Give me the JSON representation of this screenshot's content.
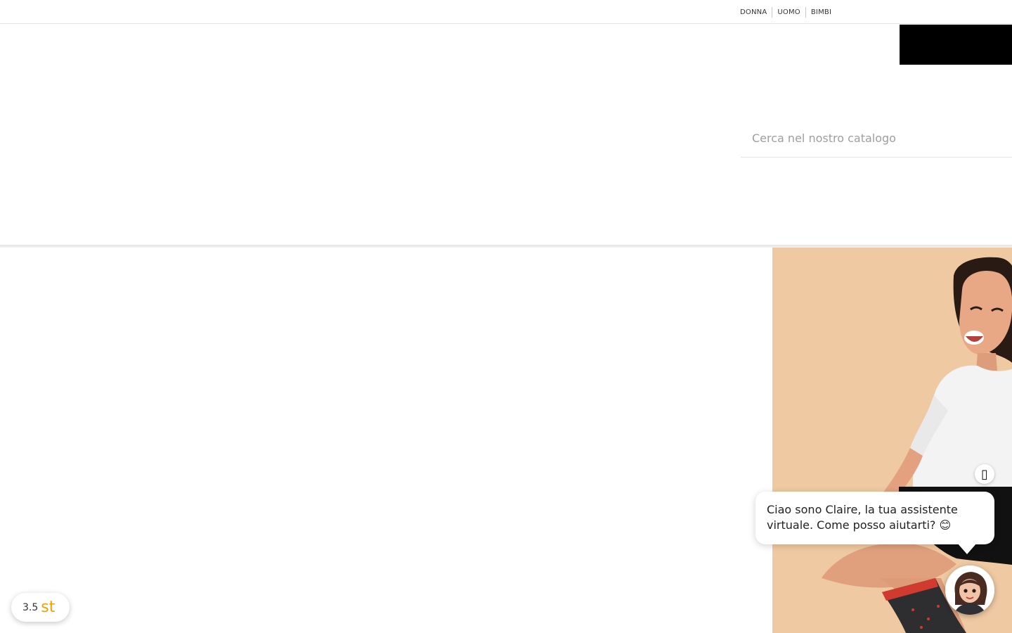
{
  "top_nav": {
    "items": [
      {
        "label": "DONNA"
      },
      {
        "label": "UOMO"
      },
      {
        "label": "BIMBI"
      }
    ]
  },
  "search": {
    "placeholder": "Cerca nel nostro catalogo",
    "value": ""
  },
  "chat": {
    "close_icon": "close-icon",
    "message": "Ciao sono Claire, la tua assistente virtuale. Come posso aiutarti? 😊",
    "avatar_icon": "assistant-avatar"
  },
  "rating": {
    "value": "3.5",
    "logo_text": "st"
  },
  "colors": {
    "hero_background": "#efc9a2",
    "rating_logo": "#f0a100",
    "black_block": "#000000"
  }
}
